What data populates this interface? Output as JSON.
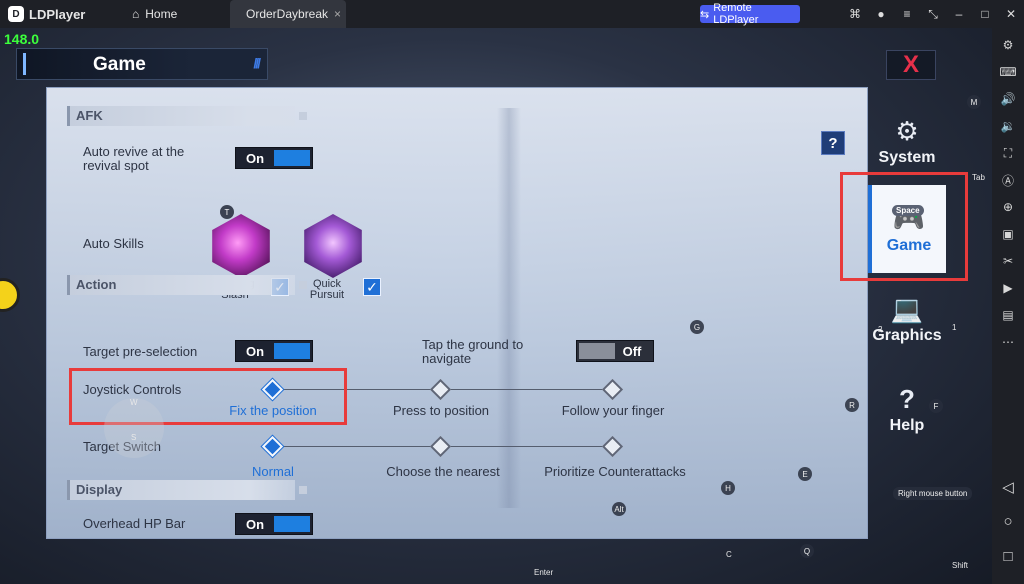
{
  "titlebar": {
    "app_name": "LDPlayer",
    "tabs": [
      {
        "label": "Home"
      },
      {
        "label": "OrderDaybreak"
      }
    ],
    "remote_button": "Remote LDPlayer",
    "tab_close": "×"
  },
  "overlay": {
    "fps": "148.0",
    "header_title": "Game",
    "header_stripes": "///",
    "close": "X"
  },
  "settings": {
    "help": "?",
    "sections": {
      "afk": "AFK",
      "action": "Action",
      "display": "Display"
    },
    "auto_revive": {
      "label": "Auto revive at the revival spot",
      "state": "On"
    },
    "auto_skills": {
      "label": "Auto Skills",
      "skills": [
        {
          "name": "Splitting Slash",
          "key": "T",
          "checked": true
        },
        {
          "name": "Quick Pursuit",
          "key": "",
          "checked": true
        }
      ]
    },
    "target_preselection": {
      "label": "Target pre-selection",
      "state": "On"
    },
    "tap_ground": {
      "label": "Tap the ground to navigate",
      "state": "Off"
    },
    "joystick_controls": {
      "label": "Joystick Controls",
      "options": [
        "Fix the position",
        "Press to position",
        "Follow your finger"
      ],
      "selected": "Fix the position"
    },
    "target_switch": {
      "label": "Target Switch",
      "options": [
        "Normal",
        "Choose the nearest",
        "Prioritize Counterattacks"
      ],
      "selected": "Normal"
    },
    "overhead_hp": {
      "label": "Overhead HP Bar",
      "state": "On"
    }
  },
  "side_tabs": [
    {
      "label": "System",
      "icon": "gear-icon"
    },
    {
      "label": "Game",
      "icon": "gamepad-icon",
      "active": true,
      "key": "Space"
    },
    {
      "label": "Graphics",
      "icon": "laptop-icon"
    },
    {
      "label": "Help",
      "icon": "question-icon"
    }
  ],
  "key_hints": {
    "m": "M",
    "tab": "Tab",
    "g": "G",
    "one": "1",
    "two": "2",
    "r": "R",
    "f": "F",
    "e": "E",
    "h": "H",
    "alt": "Alt",
    "c": "C",
    "q": "Q",
    "enter": "Enter",
    "shift": "Shift",
    "w": "W",
    "s": "S",
    "right_mouse": "Right mouse button"
  },
  "colors": {
    "accent_blue": "#1f6fd6",
    "highlight_red": "#e83b3b",
    "remote_button": "#4a5cf0",
    "fps_green": "#3cff3c"
  }
}
